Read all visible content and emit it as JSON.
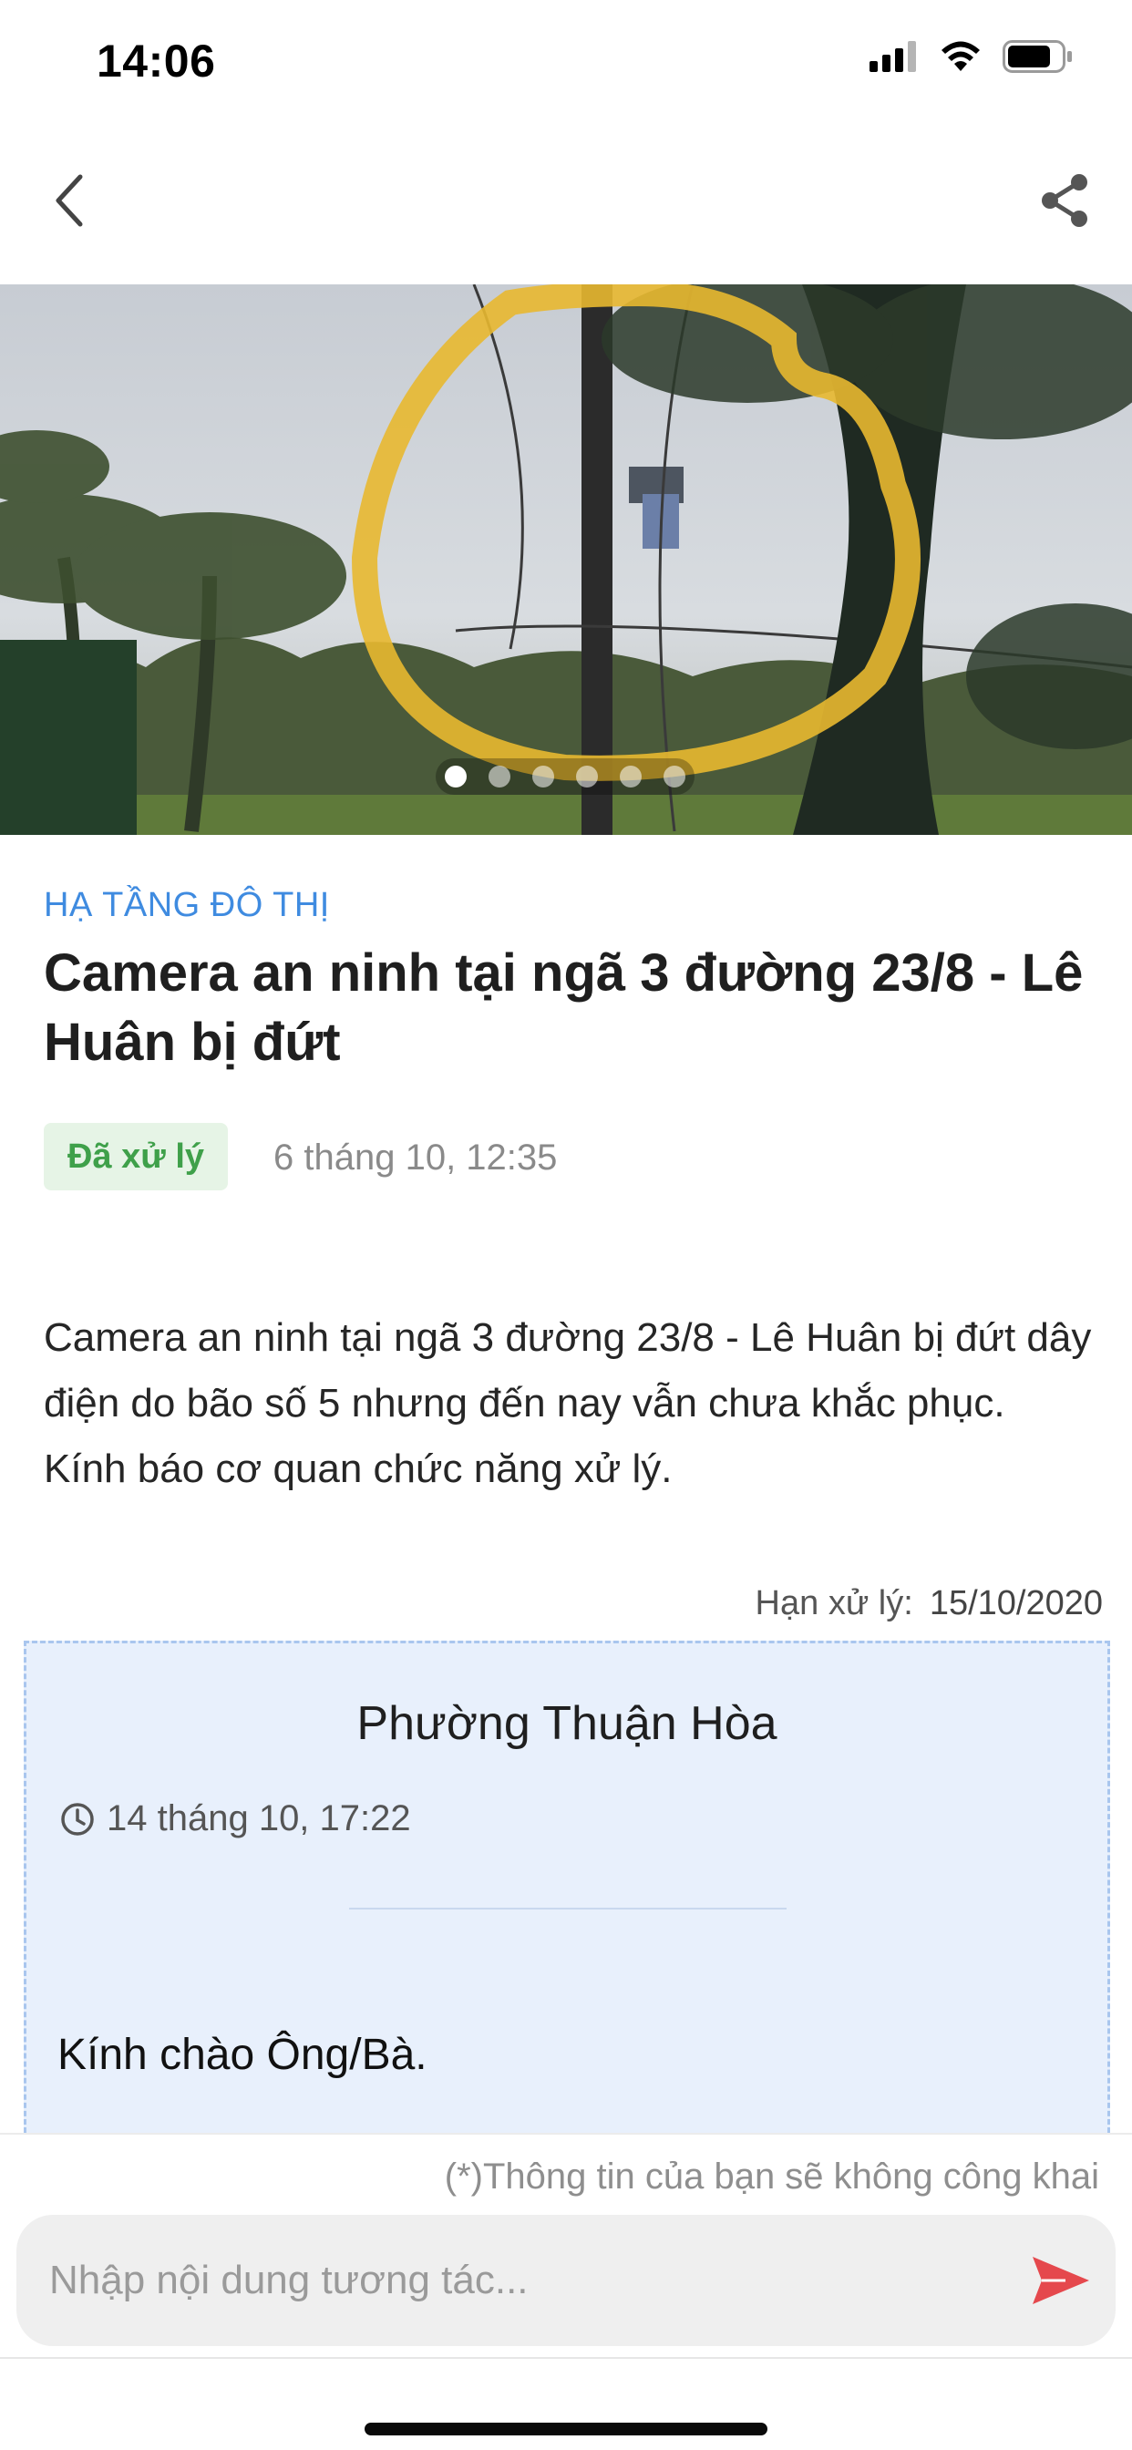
{
  "status_bar": {
    "time": "14:06",
    "icons": [
      "cellular-signal-icon",
      "wifi-icon",
      "battery-icon"
    ]
  },
  "nav": {
    "back_icon": "chevron-left-icon",
    "share_icon": "share-icon"
  },
  "carousel": {
    "image_count": 6,
    "active_index": 0
  },
  "report": {
    "category": "HẠ TẦNG ĐÔ THỊ",
    "title": "Camera an ninh tại ngã 3 đường 23/8 - Lê Huân bị đứt",
    "status": "Đã xử lý",
    "posted_time": "6 tháng 10, 12:35",
    "description": "Camera an ninh tại ngã 3 đường 23/8 - Lê Huân bị đứt dây điện do bão số 5 nhưng đến nay vẫn chưa khắc phục. Kính báo cơ quan chức năng xử lý.",
    "deadline_label": "Hạn xử lý:",
    "deadline_value": "15/10/2020"
  },
  "response": {
    "responder": "Phường Thuận Hòa",
    "time": "14 tháng 10, 17:22",
    "greeting": "Kính chào Ông/Bà."
  },
  "composer": {
    "privacy_note": "(*)Thông tin của bạn sẽ không công khai",
    "placeholder": "Nhập nội dung tương tác...",
    "value": ""
  },
  "colors": {
    "category": "#3f8be0",
    "status_badge_bg": "#e6f4e6",
    "status_badge_text": "#3fa04a",
    "response_card_bg": "#e8f0fc",
    "send_icon": "#e5484d"
  }
}
